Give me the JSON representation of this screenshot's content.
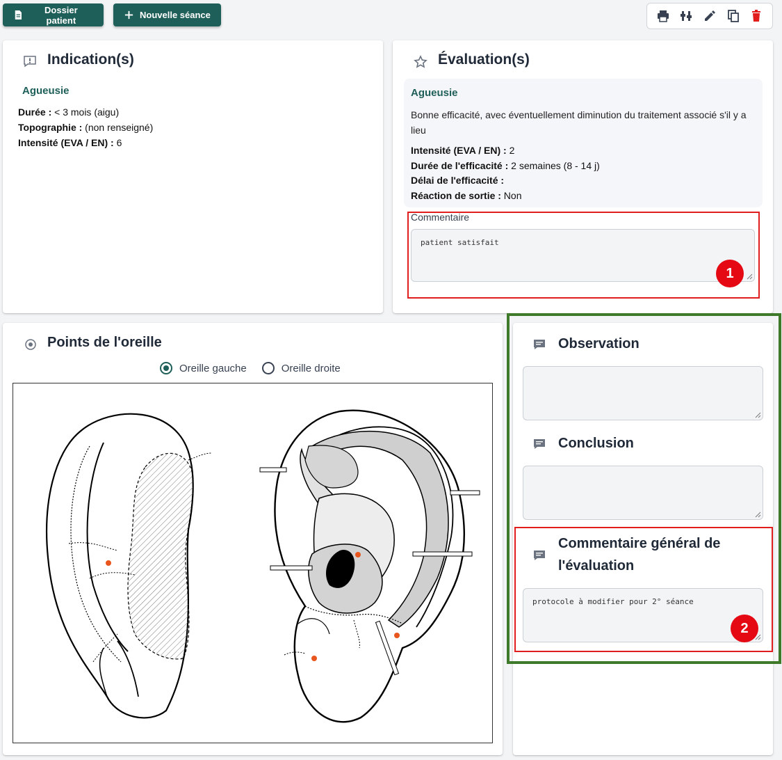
{
  "header": {
    "dossier_label": "Dossier patient",
    "new_session_label": "Nouvelle séance"
  },
  "toolbar": {
    "icons": [
      "printer-icon",
      "adjust-icon",
      "edit-icon",
      "copy-icon",
      "delete-icon"
    ],
    "delete_color": "#e11d1d"
  },
  "indication": {
    "title": "Indication(s)",
    "name": "Agueusie",
    "fields": [
      {
        "label": "Durée :",
        "value": " < 3 mois (aigu)"
      },
      {
        "label": "Topographie :",
        "value": " (non renseigné)"
      },
      {
        "label": "Intensité (EVA / EN) :",
        "value": " 6"
      }
    ]
  },
  "evaluation": {
    "title": "Évaluation(s)",
    "name": "Agueusie",
    "description": "Bonne efficacité, avec éventuellement diminution du traitement associé s'il y a lieu",
    "fields": [
      {
        "label": "Intensité (EVA / EN) :",
        "value": " 2"
      },
      {
        "label": "Durée de l'efficacité :",
        "value": " 2 semaines (8 - 14 j)"
      },
      {
        "label": "Délai de l'efficacité :",
        "value": ""
      },
      {
        "label": "Réaction de sortie :",
        "value": " Non"
      }
    ],
    "comment_label": "Commentaire",
    "comment_value": "patient satisfait"
  },
  "ear_points": {
    "title": "Points de l'oreille",
    "option_left": "Oreille gauche",
    "option_right": "Oreille droite",
    "selected": "left"
  },
  "observation": {
    "title": "Observation",
    "value": ""
  },
  "conclusion": {
    "title": "Conclusion",
    "value": ""
  },
  "general_comment": {
    "title_line1": "Commentaire général de",
    "title_line2": "l'évaluation",
    "value": "protocole à modifier pour 2° séance"
  },
  "annotations": {
    "badge1": "1",
    "badge2": "2",
    "red": "#e11d1d",
    "green": "#3f7a2b"
  },
  "colors": {
    "primary": "#1f5f59",
    "point": "#e8561e"
  }
}
